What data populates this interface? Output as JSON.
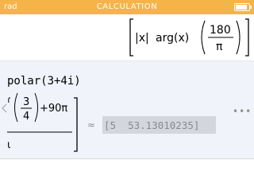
{
  "titlebar": {
    "angle_mode": "rad",
    "title": "CALCULATION",
    "battery_level": 0.85,
    "color": "#f6b347"
  },
  "previous_result": {
    "abs_left": "|x|",
    "func": "arg(x)",
    "numerator": "180",
    "denominator": "π"
  },
  "current": {
    "input": "polar(3+4i)",
    "exact_tail": "+90π",
    "frac_numerator": "3",
    "frac_denominator": "4",
    "partial_denominator": "ι",
    "scroll_left_icon": "chevron-left-icon",
    "approx_symbol": "≈",
    "approx_value": "[5  53.13010235]",
    "more_icon": "ellipsis-icon",
    "more_label": "•••"
  }
}
